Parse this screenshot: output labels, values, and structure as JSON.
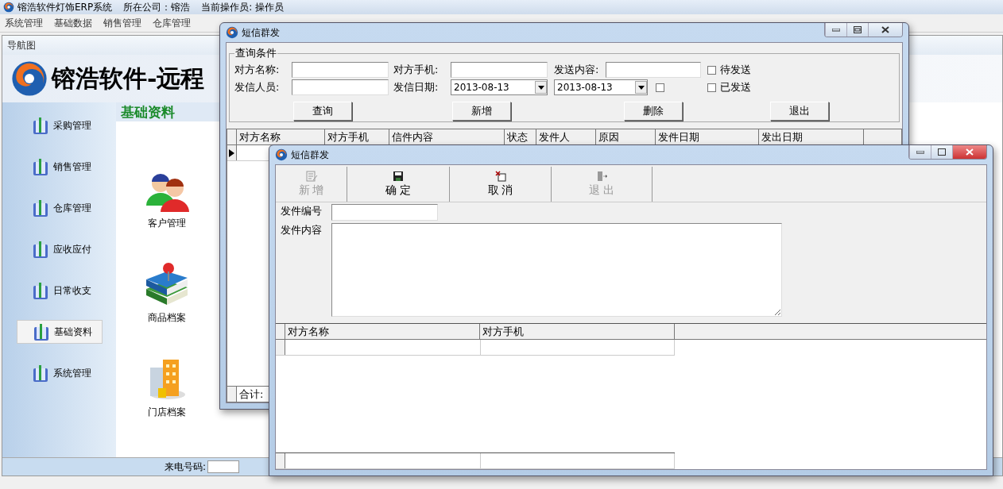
{
  "app": {
    "title": "镕浩软件灯饰ERP系统",
    "company": "所在公司：镕浩",
    "operator": "当前操作员: 操作员"
  },
  "menu": [
    "系统管理",
    "基础数据",
    "销售管理",
    "仓库管理"
  ],
  "nav": {
    "header": "导航图",
    "banner": "镕浩软件-远程"
  },
  "sidebar": [
    {
      "label": "采购管理",
      "selected": false
    },
    {
      "label": "销售管理",
      "selected": false
    },
    {
      "label": "仓库管理",
      "selected": false
    },
    {
      "label": "应收应付",
      "selected": false
    },
    {
      "label": "日常收支",
      "selected": false
    },
    {
      "label": "基础资料",
      "selected": true
    },
    {
      "label": "系统管理",
      "selected": false
    }
  ],
  "section": {
    "title": "基础资料",
    "modules": [
      {
        "label": "客户管理",
        "kind": "customers"
      },
      {
        "label": "商品档案",
        "kind": "products"
      },
      {
        "label": "门店档案",
        "kind": "stores"
      }
    ]
  },
  "status_bar": {
    "caller_label": "来电号码:"
  },
  "query_window": {
    "title": "短信群发",
    "group_title": "查询条件",
    "fields": {
      "name_label": "对方名称:",
      "phone_label": "对方手机:",
      "content_label": "发送内容:",
      "sender_label": "发信人员:",
      "date_label": "发信日期:",
      "date_from": "2013-08-13",
      "date_to": "2013-08-13",
      "date_enabled": false
    },
    "filters": [
      {
        "label": "待发送",
        "checked": false
      },
      {
        "label": "已发送",
        "checked": false
      }
    ],
    "buttons": [
      "查询",
      "新增",
      "删除",
      "退出"
    ],
    "table": {
      "columns": [
        "对方名称",
        "对方手机",
        "信件内容",
        "状态",
        "发件人",
        "原因",
        "发件日期",
        "发出日期"
      ],
      "footer": "合计:"
    }
  },
  "edit_window": {
    "title": "短信群发",
    "toolbar": [
      {
        "label": "新 增",
        "kind": "new",
        "disabled": true
      },
      {
        "label": "确 定",
        "kind": "save",
        "disabled": false
      },
      {
        "label": "取 消",
        "kind": "cancel",
        "disabled": false
      },
      {
        "label": "退 出",
        "kind": "exit",
        "disabled": true
      }
    ],
    "number_label": "发件编号",
    "content_label": "发件内容",
    "table": {
      "columns": [
        "对方名称",
        "对方手机"
      ]
    }
  }
}
